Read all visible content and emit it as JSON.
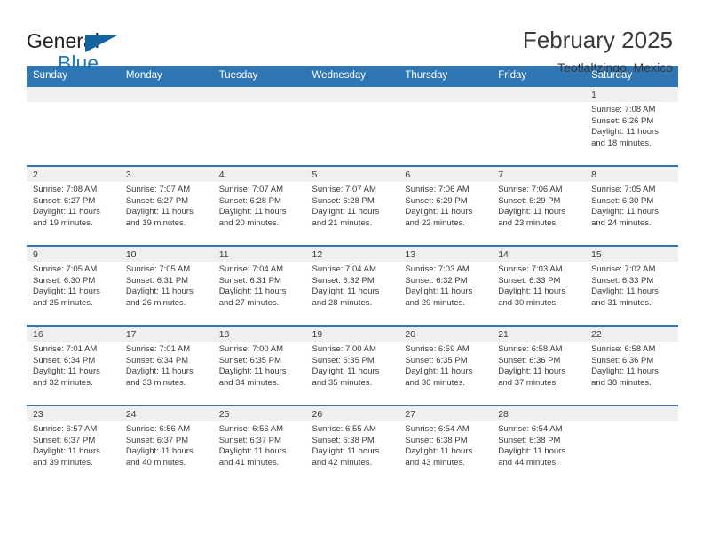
{
  "brand": {
    "name_part1": "General",
    "name_part2": "Blue",
    "triangle_icon": "triangle-icon",
    "accent_color": "#1f7ac0",
    "header_color": "#2f76b4"
  },
  "header": {
    "title": "February 2025",
    "subtitle": "Teotlaltzingo, Mexico"
  },
  "weekday_headers": [
    "Sunday",
    "Monday",
    "Tuesday",
    "Wednesday",
    "Thursday",
    "Friday",
    "Saturday"
  ],
  "labels": {
    "sunrise_prefix": "Sunrise:",
    "sunset_prefix": "Sunset:",
    "daylight_prefix": "Daylight:"
  },
  "weeks": [
    [
      {
        "day": "",
        "sunrise": "",
        "sunset": "",
        "daylight": "",
        "empty": true
      },
      {
        "day": "",
        "sunrise": "",
        "sunset": "",
        "daylight": "",
        "empty": true
      },
      {
        "day": "",
        "sunrise": "",
        "sunset": "",
        "daylight": "",
        "empty": true
      },
      {
        "day": "",
        "sunrise": "",
        "sunset": "",
        "daylight": "",
        "empty": true
      },
      {
        "day": "",
        "sunrise": "",
        "sunset": "",
        "daylight": "",
        "empty": true
      },
      {
        "day": "",
        "sunrise": "",
        "sunset": "",
        "daylight": "",
        "empty": true
      },
      {
        "day": "1",
        "sunrise": "Sunrise: 7:08 AM",
        "sunset": "Sunset: 6:26 PM",
        "daylight": "Daylight: 11 hours and 18 minutes.",
        "empty": false
      }
    ],
    [
      {
        "day": "2",
        "sunrise": "Sunrise: 7:08 AM",
        "sunset": "Sunset: 6:27 PM",
        "daylight": "Daylight: 11 hours and 19 minutes.",
        "empty": false
      },
      {
        "day": "3",
        "sunrise": "Sunrise: 7:07 AM",
        "sunset": "Sunset: 6:27 PM",
        "daylight": "Daylight: 11 hours and 19 minutes.",
        "empty": false
      },
      {
        "day": "4",
        "sunrise": "Sunrise: 7:07 AM",
        "sunset": "Sunset: 6:28 PM",
        "daylight": "Daylight: 11 hours and 20 minutes.",
        "empty": false
      },
      {
        "day": "5",
        "sunrise": "Sunrise: 7:07 AM",
        "sunset": "Sunset: 6:28 PM",
        "daylight": "Daylight: 11 hours and 21 minutes.",
        "empty": false
      },
      {
        "day": "6",
        "sunrise": "Sunrise: 7:06 AM",
        "sunset": "Sunset: 6:29 PM",
        "daylight": "Daylight: 11 hours and 22 minutes.",
        "empty": false
      },
      {
        "day": "7",
        "sunrise": "Sunrise: 7:06 AM",
        "sunset": "Sunset: 6:29 PM",
        "daylight": "Daylight: 11 hours and 23 minutes.",
        "empty": false
      },
      {
        "day": "8",
        "sunrise": "Sunrise: 7:05 AM",
        "sunset": "Sunset: 6:30 PM",
        "daylight": "Daylight: 11 hours and 24 minutes.",
        "empty": false
      }
    ],
    [
      {
        "day": "9",
        "sunrise": "Sunrise: 7:05 AM",
        "sunset": "Sunset: 6:30 PM",
        "daylight": "Daylight: 11 hours and 25 minutes.",
        "empty": false
      },
      {
        "day": "10",
        "sunrise": "Sunrise: 7:05 AM",
        "sunset": "Sunset: 6:31 PM",
        "daylight": "Daylight: 11 hours and 26 minutes.",
        "empty": false
      },
      {
        "day": "11",
        "sunrise": "Sunrise: 7:04 AM",
        "sunset": "Sunset: 6:31 PM",
        "daylight": "Daylight: 11 hours and 27 minutes.",
        "empty": false
      },
      {
        "day": "12",
        "sunrise": "Sunrise: 7:04 AM",
        "sunset": "Sunset: 6:32 PM",
        "daylight": "Daylight: 11 hours and 28 minutes.",
        "empty": false
      },
      {
        "day": "13",
        "sunrise": "Sunrise: 7:03 AM",
        "sunset": "Sunset: 6:32 PM",
        "daylight": "Daylight: 11 hours and 29 minutes.",
        "empty": false
      },
      {
        "day": "14",
        "sunrise": "Sunrise: 7:03 AM",
        "sunset": "Sunset: 6:33 PM",
        "daylight": "Daylight: 11 hours and 30 minutes.",
        "empty": false
      },
      {
        "day": "15",
        "sunrise": "Sunrise: 7:02 AM",
        "sunset": "Sunset: 6:33 PM",
        "daylight": "Daylight: 11 hours and 31 minutes.",
        "empty": false
      }
    ],
    [
      {
        "day": "16",
        "sunrise": "Sunrise: 7:01 AM",
        "sunset": "Sunset: 6:34 PM",
        "daylight": "Daylight: 11 hours and 32 minutes.",
        "empty": false
      },
      {
        "day": "17",
        "sunrise": "Sunrise: 7:01 AM",
        "sunset": "Sunset: 6:34 PM",
        "daylight": "Daylight: 11 hours and 33 minutes.",
        "empty": false
      },
      {
        "day": "18",
        "sunrise": "Sunrise: 7:00 AM",
        "sunset": "Sunset: 6:35 PM",
        "daylight": "Daylight: 11 hours and 34 minutes.",
        "empty": false
      },
      {
        "day": "19",
        "sunrise": "Sunrise: 7:00 AM",
        "sunset": "Sunset: 6:35 PM",
        "daylight": "Daylight: 11 hours and 35 minutes.",
        "empty": false
      },
      {
        "day": "20",
        "sunrise": "Sunrise: 6:59 AM",
        "sunset": "Sunset: 6:35 PM",
        "daylight": "Daylight: 11 hours and 36 minutes.",
        "empty": false
      },
      {
        "day": "21",
        "sunrise": "Sunrise: 6:58 AM",
        "sunset": "Sunset: 6:36 PM",
        "daylight": "Daylight: 11 hours and 37 minutes.",
        "empty": false
      },
      {
        "day": "22",
        "sunrise": "Sunrise: 6:58 AM",
        "sunset": "Sunset: 6:36 PM",
        "daylight": "Daylight: 11 hours and 38 minutes.",
        "empty": false
      }
    ],
    [
      {
        "day": "23",
        "sunrise": "Sunrise: 6:57 AM",
        "sunset": "Sunset: 6:37 PM",
        "daylight": "Daylight: 11 hours and 39 minutes.",
        "empty": false
      },
      {
        "day": "24",
        "sunrise": "Sunrise: 6:56 AM",
        "sunset": "Sunset: 6:37 PM",
        "daylight": "Daylight: 11 hours and 40 minutes.",
        "empty": false
      },
      {
        "day": "25",
        "sunrise": "Sunrise: 6:56 AM",
        "sunset": "Sunset: 6:37 PM",
        "daylight": "Daylight: 11 hours and 41 minutes.",
        "empty": false
      },
      {
        "day": "26",
        "sunrise": "Sunrise: 6:55 AM",
        "sunset": "Sunset: 6:38 PM",
        "daylight": "Daylight: 11 hours and 42 minutes.",
        "empty": false
      },
      {
        "day": "27",
        "sunrise": "Sunrise: 6:54 AM",
        "sunset": "Sunset: 6:38 PM",
        "daylight": "Daylight: 11 hours and 43 minutes.",
        "empty": false
      },
      {
        "day": "28",
        "sunrise": "Sunrise: 6:54 AM",
        "sunset": "Sunset: 6:38 PM",
        "daylight": "Daylight: 11 hours and 44 minutes.",
        "empty": false
      },
      {
        "day": "",
        "sunrise": "",
        "sunset": "",
        "daylight": "",
        "empty": true
      }
    ]
  ]
}
